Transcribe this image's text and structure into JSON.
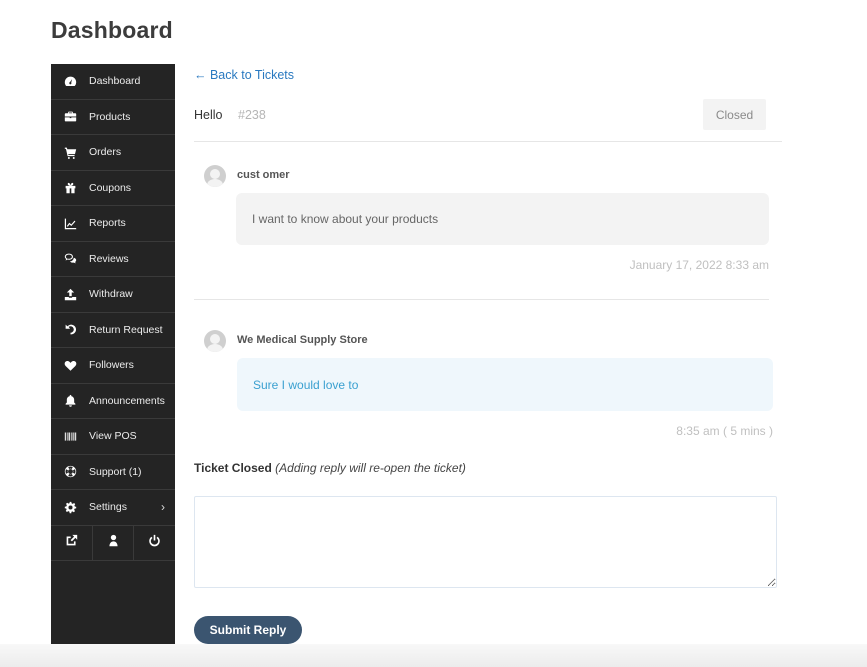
{
  "page": {
    "title": "Dashboard"
  },
  "sidebar": {
    "items": [
      {
        "label": "Dashboard",
        "icon": "dashboard-gauge-icon"
      },
      {
        "label": "Products",
        "icon": "briefcase-icon"
      },
      {
        "label": "Orders",
        "icon": "cart-icon"
      },
      {
        "label": "Coupons",
        "icon": "gift-icon"
      },
      {
        "label": "Reports",
        "icon": "line-chart-icon"
      },
      {
        "label": "Reviews",
        "icon": "comments-icon"
      },
      {
        "label": "Withdraw",
        "icon": "upload-icon"
      },
      {
        "label": "Return Request",
        "icon": "undo-icon"
      },
      {
        "label": "Followers",
        "icon": "heart-icon"
      },
      {
        "label": "Announcements",
        "icon": "bell-icon"
      },
      {
        "label": "View POS",
        "icon": "barcode-icon"
      },
      {
        "label": "Support (1)",
        "icon": "lifebuoy-icon"
      },
      {
        "label": "Settings",
        "icon": "gear-icon",
        "has_submenu": true
      }
    ],
    "bottom_buttons": [
      {
        "name": "visit-store",
        "icon": "external-link-icon"
      },
      {
        "name": "edit-account",
        "icon": "user-icon"
      },
      {
        "name": "log-out",
        "icon": "power-icon"
      }
    ],
    "submenu_chevron": "›"
  },
  "ticket": {
    "back_link": "← Back to Tickets",
    "title": "Hello",
    "id": "#238",
    "status": "Closed",
    "messages": [
      {
        "author": "cust omer",
        "role": "customer",
        "text": "I want to know about your products",
        "time": "January 17, 2022 8:33 am"
      },
      {
        "author": "We Medical Supply Store",
        "role": "vendor",
        "text": "Sure I would love to",
        "time": "8:35 am ( 5 mins )"
      }
    ],
    "closed_label": "Ticket Closed",
    "closed_note": "(Adding reply will re-open the ticket)",
    "reply_value": "",
    "submit_label": "Submit Reply"
  }
}
